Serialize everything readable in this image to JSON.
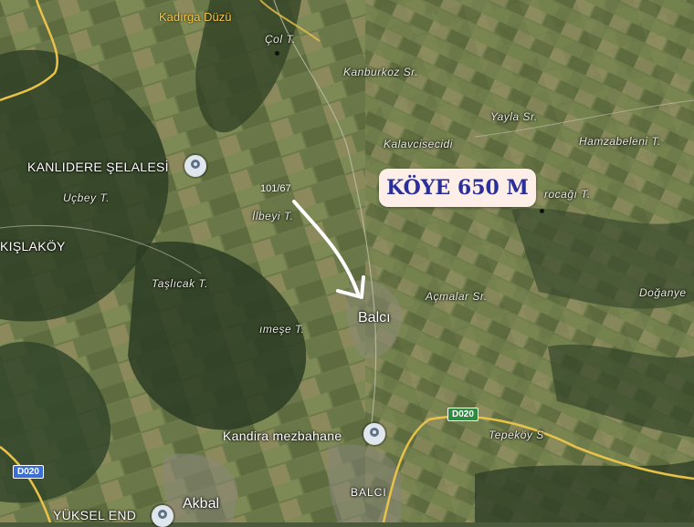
{
  "labels": {
    "kadirga_duzu": "Kadırga Düzü",
    "col": "Çol T.",
    "kanburkoz": "Kanburkoz Sr.",
    "yayla": "Yayla Sr.",
    "kalavcisecidi": "Kalavcisecidi",
    "hamzabeleni": "Hamzabeleni T.",
    "kanlidere": "KANLIDERE ŞELALESİ",
    "ucbey": "Uçbey T.",
    "ilbeyi": "İlbeyi T.",
    "rocagi": "rocağı T.",
    "kislakoy": "KIŞLAKÖY",
    "taslicak": "Taşlıcak T.",
    "acmalar": "Açmalar Sr.",
    "doganye": "Doğanye",
    "balci": "Balcı",
    "imese": "ımeşe T.",
    "kandira": "Kandira mezbahane",
    "tepekoy": "Tepeköy S",
    "yuksel": "YÜKSEL END",
    "akbal": "Akbal",
    "balci_caps": "BALCI",
    "d020_left": "D020",
    "d020_right": "D020"
  },
  "annotation": {
    "text": "101/67"
  },
  "badge": {
    "text": "KÖYE 650 M"
  },
  "icons": {
    "pin": "place-pin-icon",
    "arrow": "arrow-icon"
  }
}
